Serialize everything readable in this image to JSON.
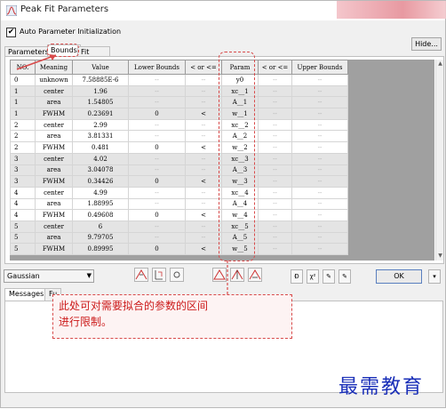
{
  "window": {
    "title": "Peak Fit Parameters"
  },
  "options": {
    "auto_param_label": "Auto Parameter Initialization",
    "auto_param_checked": true,
    "hide_label": "Hide..."
  },
  "tabs": [
    {
      "label": "Parameters",
      "active": false
    },
    {
      "label": "Bounds",
      "active": true
    },
    {
      "label": "Fit Control",
      "active": false
    }
  ],
  "table": {
    "headers": [
      "NO.",
      "Meaning",
      "Value",
      "Lower Bounds",
      "< or <=",
      "Param",
      "< or <=",
      "Upper Bounds"
    ],
    "rows": [
      {
        "no": "0",
        "meaning": "unknown",
        "value": "7.58885E-6",
        "lower": "--",
        "op1": "--",
        "param": "y0",
        "op2": "--",
        "upper": "--"
      },
      {
        "no": "1",
        "meaning": "center",
        "value": "1.96",
        "lower": "--",
        "op1": "--",
        "param": "xc__1",
        "op2": "--",
        "upper": "--"
      },
      {
        "no": "1",
        "meaning": "area",
        "value": "1.54805",
        "lower": "--",
        "op1": "--",
        "param": "A__1",
        "op2": "--",
        "upper": "--"
      },
      {
        "no": "1",
        "meaning": "FWHM",
        "value": "0.23691",
        "lower": "0",
        "op1": "<",
        "param": "w__1",
        "op2": "--",
        "upper": "--"
      },
      {
        "no": "2",
        "meaning": "center",
        "value": "2.99",
        "lower": "--",
        "op1": "--",
        "param": "xc__2",
        "op2": "--",
        "upper": "--"
      },
      {
        "no": "2",
        "meaning": "area",
        "value": "3.81331",
        "lower": "--",
        "op1": "--",
        "param": "A__2",
        "op2": "--",
        "upper": "--"
      },
      {
        "no": "2",
        "meaning": "FWHM",
        "value": "0.481",
        "lower": "0",
        "op1": "<",
        "param": "w__2",
        "op2": "--",
        "upper": "--"
      },
      {
        "no": "3",
        "meaning": "center",
        "value": "4.02",
        "lower": "--",
        "op1": "--",
        "param": "xc__3",
        "op2": "--",
        "upper": "--"
      },
      {
        "no": "3",
        "meaning": "area",
        "value": "3.04078",
        "lower": "--",
        "op1": "--",
        "param": "A__3",
        "op2": "--",
        "upper": "--"
      },
      {
        "no": "3",
        "meaning": "FWHM",
        "value": "0.34426",
        "lower": "0",
        "op1": "<",
        "param": "w__3",
        "op2": "--",
        "upper": "--"
      },
      {
        "no": "4",
        "meaning": "center",
        "value": "4.99",
        "lower": "--",
        "op1": "--",
        "param": "xc__4",
        "op2": "--",
        "upper": "--"
      },
      {
        "no": "4",
        "meaning": "area",
        "value": "1.88995",
        "lower": "--",
        "op1": "--",
        "param": "A__4",
        "op2": "--",
        "upper": "--"
      },
      {
        "no": "4",
        "meaning": "FWHM",
        "value": "0.49608",
        "lower": "0",
        "op1": "<",
        "param": "w__4",
        "op2": "--",
        "upper": "--"
      },
      {
        "no": "5",
        "meaning": "center",
        "value": "6",
        "lower": "--",
        "op1": "--",
        "param": "xc__5",
        "op2": "--",
        "upper": "--"
      },
      {
        "no": "5",
        "meaning": "area",
        "value": "9.79705",
        "lower": "--",
        "op1": "--",
        "param": "A__5",
        "op2": "--",
        "upper": "--"
      },
      {
        "no": "5",
        "meaning": "FWHM",
        "value": "0.89995",
        "lower": "0",
        "op1": "<",
        "param": "w__5",
        "op2": "--",
        "upper": "--"
      }
    ]
  },
  "toolbar": {
    "function_value": "Gaussian",
    "ok_label": "OK"
  },
  "bottom_tabs": [
    {
      "label": "Messages"
    },
    {
      "label": "Fu"
    }
  ],
  "annotation": {
    "line1": "此处可对需要拟合的参数的区间",
    "line2": "进行限制。"
  },
  "watermark": "最需教育",
  "colors": {
    "annotation_red": "#d84a4a",
    "watermark_blue": "#1a2fb8",
    "ok_border": "#5a7fbf"
  },
  "icons": {
    "app": "peak-fit-icon",
    "toolbar": [
      "peak-up-icon",
      "fix-params-icon",
      "peak-triangle-icon",
      "peak-split-icon",
      "peak-modify-icon",
      "step-icon",
      "chi-square-icon",
      "iterate-one-icon",
      "iterate-all-icon"
    ]
  }
}
